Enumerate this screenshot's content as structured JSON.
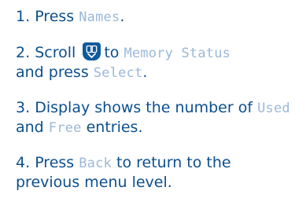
{
  "colors": {
    "text": "#0b4f8e",
    "display_text": "#9bb8d8",
    "key_fill": "#0d5a9c"
  },
  "steps": [
    {
      "number": "1.",
      "parts": [
        "Press ",
        "Names",
        "."
      ]
    },
    {
      "number": "2.",
      "parts": [
        "Scroll ",
        "to ",
        "Memory Status",
        "and press ",
        "Select",
        "."
      ]
    },
    {
      "number": "3.",
      "parts": [
        "Display shows the number of ",
        "Used",
        "and ",
        "Free",
        " entries."
      ]
    },
    {
      "number": "4.",
      "parts": [
        "Press ",
        "Back",
        " to return to the",
        "previous menu level."
      ]
    }
  ],
  "icons": {
    "scroll_key": "phonebook-scroll-key-icon"
  }
}
